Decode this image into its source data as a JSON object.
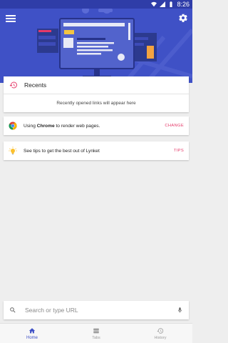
{
  "status_bar": {
    "time": "8:26"
  },
  "recents": {
    "title": "Recents",
    "empty_text": "Recently opened links will appear here"
  },
  "browser_card": {
    "text_prefix": "Using ",
    "browser_name": "Chrome",
    "text_suffix": " to render web pages.",
    "action_label": "CHANGE"
  },
  "tips_card": {
    "text": "See tips to get the best out of Lynket",
    "action_label": "TIPS"
  },
  "search": {
    "placeholder": "Search or type URL"
  },
  "bottom_nav": {
    "items": [
      {
        "label": "Home",
        "icon": "home-icon",
        "active": true
      },
      {
        "label": "Tabs",
        "icon": "tabs-icon",
        "active": false
      },
      {
        "label": "History",
        "icon": "history-icon",
        "active": false
      }
    ]
  },
  "colors": {
    "header": "#3f51c6",
    "status_bar": "#2f3da8",
    "accent": "#e53969",
    "background": "#eeeeee"
  }
}
